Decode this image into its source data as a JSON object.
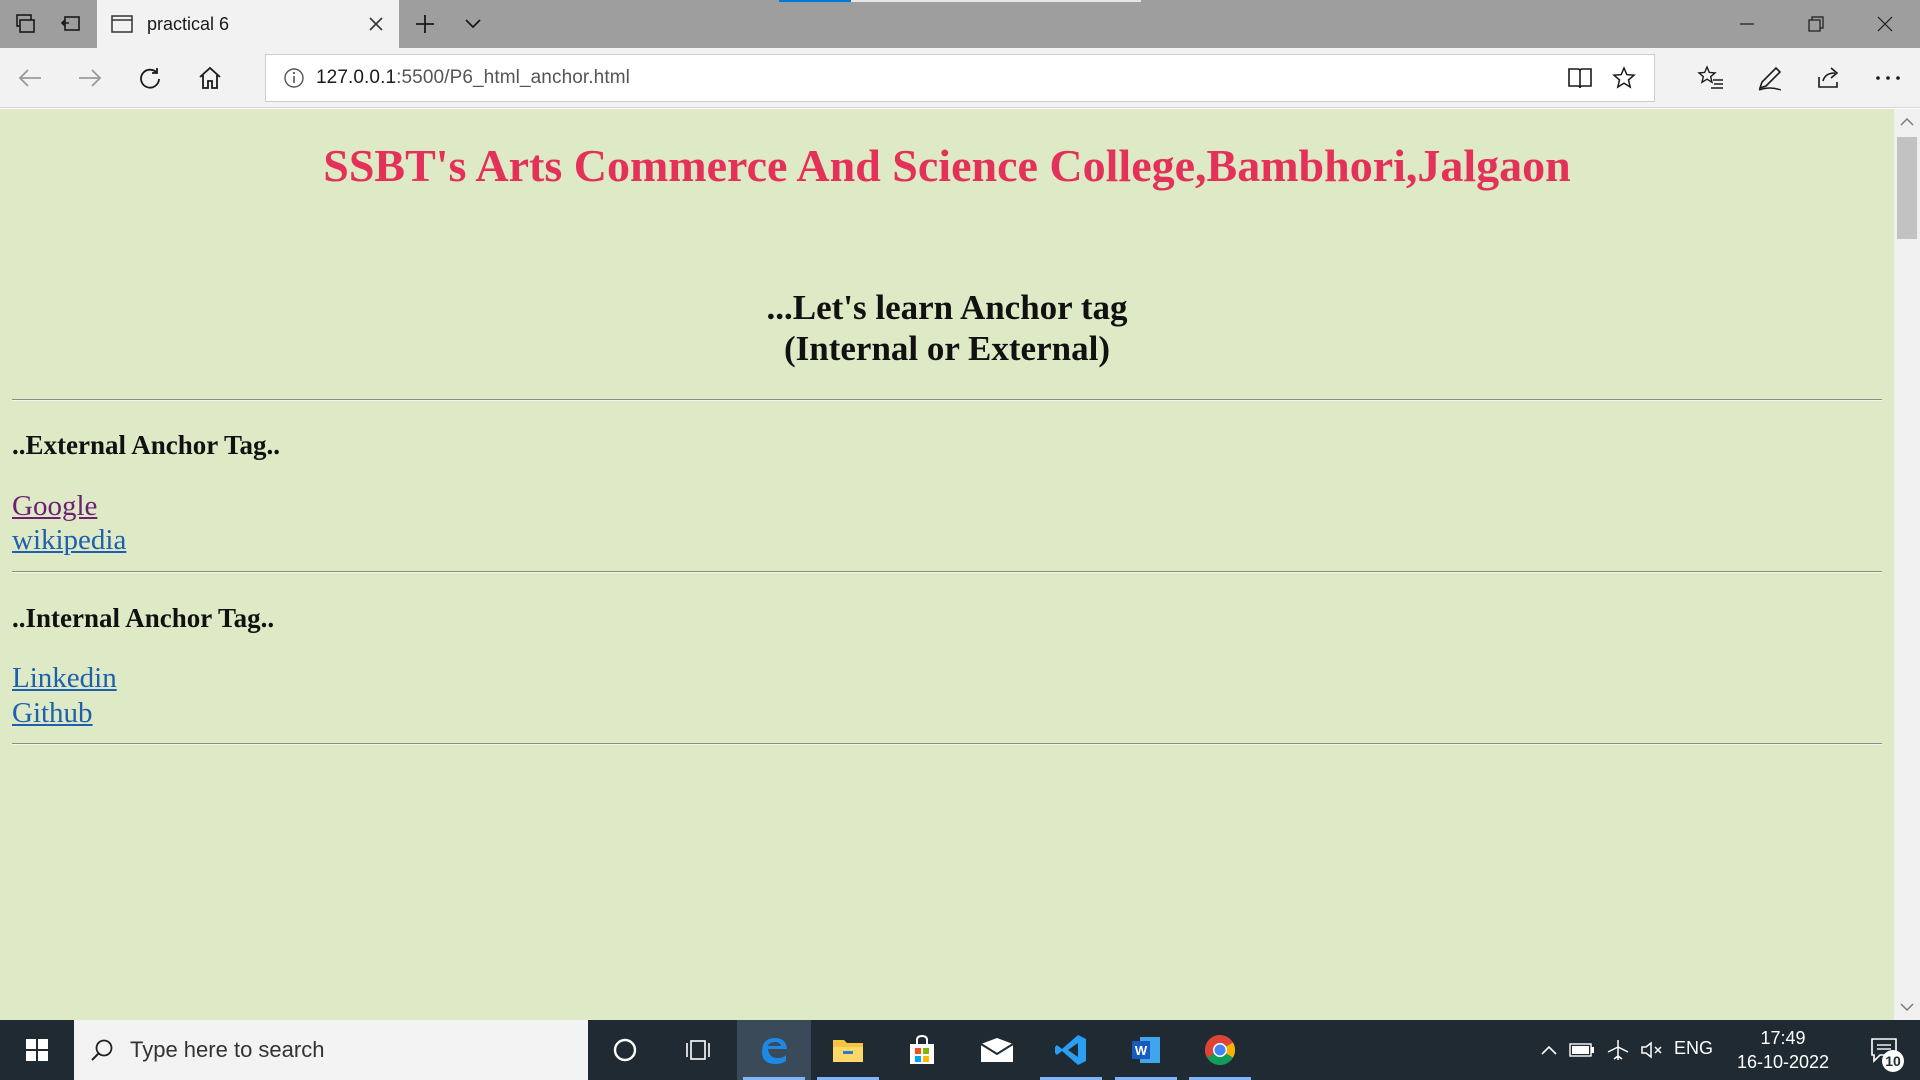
{
  "browser": {
    "tab_title": "practical 6",
    "url_host": "127.0.0.1",
    "url_rest": ":5500/P6_html_anchor.html"
  },
  "page": {
    "title": "SSBT's Arts Commerce And Science College,Bambhori,Jalgaon",
    "subtitle_line1": "...Let's learn Anchor tag",
    "subtitle_line2": "(Internal or External)",
    "external_heading": "..External Anchor Tag..",
    "external_links": [
      "Google",
      "wikipedia"
    ],
    "internal_heading": "..Internal Anchor Tag..",
    "internal_links": [
      "Linkedin",
      "Github"
    ],
    "colors": {
      "background": "#deeac5",
      "title": "#e43159",
      "visited_link": "#6c1f75",
      "link": "#1f5fb0"
    }
  },
  "taskbar": {
    "search_placeholder": "Type here to search",
    "language": "ENG",
    "time": "17:49",
    "date": "16-10-2022",
    "notification_count": "10",
    "apps": [
      "cortana-icon",
      "task-view-icon",
      "edge-icon",
      "file-explorer-icon",
      "store-icon",
      "mail-icon",
      "vscode-icon",
      "word-icon",
      "chrome-icon"
    ]
  }
}
